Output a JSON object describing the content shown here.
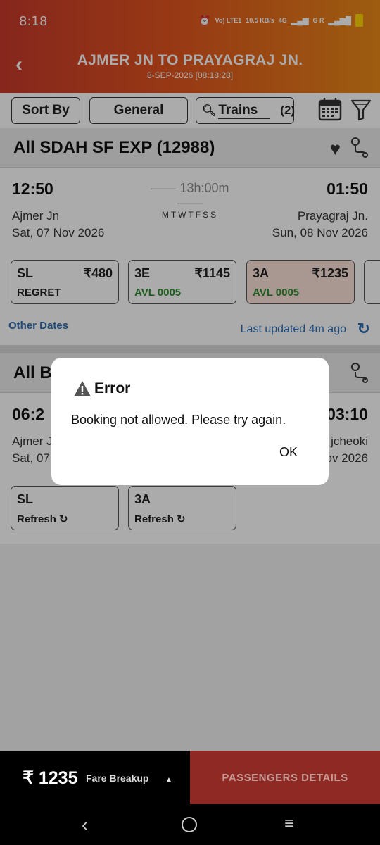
{
  "status": {
    "time": "8:18",
    "net1": "Vo) LTE1",
    "speed": "10.5 KB/s",
    "net2": "4G",
    "net3": "G R"
  },
  "header": {
    "title": "AJMER JN TO PRAYAGRAJ JN.",
    "subtitle": "8-SEP-2026 [08:18:28]"
  },
  "filters": {
    "sort": "Sort By",
    "quota": "General",
    "trains_label": "Trains",
    "trains_count": "(2)"
  },
  "train1": {
    "name": "All SDAH SF EXP (12988)",
    "dep_time": "12:50",
    "arr_time": "01:50",
    "duration": "13h:00m",
    "days": "MTWTFSS",
    "from": "Ajmer Jn",
    "from_date": "Sat, 07 Nov 2026",
    "to": "Prayagraj Jn.",
    "to_date": "Sun, 08 Nov 2026",
    "classes": [
      {
        "name": "SL",
        "price": "₹480",
        "status": "REGRET"
      },
      {
        "name": "3E",
        "price": "₹1145",
        "status": "AVL 0005"
      },
      {
        "name": "3A",
        "price": "₹1235",
        "status": "AVL 0005"
      }
    ],
    "other_dates": "Other Dates",
    "last_updated": "Last updated 4m ago"
  },
  "train2": {
    "name_partial": "All B",
    "dep_partial": "06:2",
    "arr_partial": "03:10",
    "from_partial": "Ajmer J",
    "from_date_partial": "Sat, 07",
    "to_partial": "jcheoki",
    "to_date_partial": "ov 2026",
    "classes": [
      {
        "name": "SL",
        "status": "Refresh"
      },
      {
        "name": "3A",
        "status": "Refresh"
      }
    ]
  },
  "dialog": {
    "title": "Error",
    "message": "Booking not allowed. Please try again.",
    "ok": "OK"
  },
  "footer": {
    "fare": "₹ 1235",
    "fare_breakup": "Fare Breakup",
    "passengers": "PASSENGERS DETAILS"
  }
}
